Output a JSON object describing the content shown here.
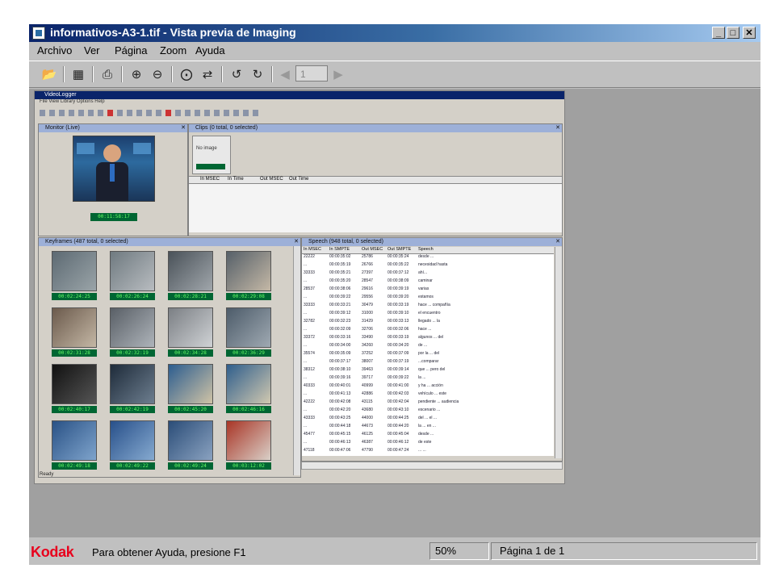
{
  "window": {
    "title": "informativos-A3-1.tif - Vista previa de Imaging",
    "controls": {
      "minimize": "_",
      "maximize": "□",
      "close": "✕"
    }
  },
  "menu": [
    "Archivo",
    "Ver",
    "Página",
    "Zoom",
    "Ayuda"
  ],
  "toolbar": {
    "page_input_value": "1"
  },
  "image_content": {
    "app_title": "VideoLogger",
    "menu_line": "File  View  Library  Options  Help",
    "monitor_title": "Monitor (Live)",
    "monitor_timecode": "00:11:58:17",
    "clips_title": "Clips (0 total, 0 selected)",
    "clips_no_image": "No image",
    "clips_columns": [
      "In MSEC",
      "In Time",
      "Out MSEC",
      "Out Time"
    ],
    "keyframes_title": "Keyframes (487 total, 0 selected)",
    "keyframe_timecodes": [
      "00:02:24:25",
      "00:02:26:24",
      "00:02:28:21",
      "00:02:29:08",
      "00:02:31:28",
      "00:02:32:19",
      "00:02:34:28",
      "00:02:36:29",
      "00:02:40:17",
      "00:02:42:19",
      "00:02:45:20",
      "00:02:46:16",
      "00:02:49:18",
      "00:02:49:22",
      "00:02:49:24",
      "00:03:12:02"
    ],
    "speech_title": "Speech (948 total, 0 selected)",
    "speech_columns": [
      "In MSEC",
      "In SMPTE",
      "Out MSEC",
      "Out SMPTE",
      "Speech"
    ],
    "speech_rows": [
      [
        "22222",
        "00:00:35:02",
        "25786",
        "00:00:35:24",
        "desde ..."
      ],
      [
        "...",
        "00:00:35:19",
        "26766",
        "00:00:35:22",
        "necesidad hasta"
      ],
      [
        "33333",
        "00:00:35:21",
        "27397",
        "00:00:37:12",
        "ahí..."
      ],
      [
        "...",
        "00:00:35:20",
        "28547",
        "00:00:38:09",
        "caminar"
      ],
      [
        "28537",
        "00:00:38:06",
        "29616",
        "00:00:39:19",
        "varias"
      ],
      [
        "...",
        "00:00:39:22",
        "29556",
        "00:00:39:20",
        "estamos"
      ],
      [
        "33333",
        "00:00:33:21",
        "30479",
        "00:00:33:19",
        "hace ... compañía"
      ],
      [
        "...",
        "00:00:39:12",
        "31000",
        "00:00:39:10",
        "el encuentro"
      ],
      [
        "32782",
        "00:00:32:23",
        "31429",
        "00:00:33:13",
        "llegado ... la"
      ],
      [
        "...",
        "00:00:32:09",
        "32706",
        "00:00:32:06",
        "hace ..."
      ],
      [
        "33372",
        "00:00:33:16",
        "33490",
        "00:00:33:19",
        "algunos ... del"
      ],
      [
        "...",
        "00:00:34:00",
        "34260",
        "00:00:34:20",
        "de ..."
      ],
      [
        "35574",
        "00:00:35:09",
        "37252",
        "00:00:37:09",
        "por la ... del"
      ],
      [
        "...",
        "00:00:37:17",
        "38007",
        "00:00:37:19",
        "...comparar"
      ],
      [
        "38312",
        "00:00:38:10",
        "39463",
        "00:00:39:14",
        "que ... pero del"
      ],
      [
        "...",
        "00:00:39:16",
        "39717",
        "00:00:39:22",
        "la ..."
      ],
      [
        "40333",
        "00:00:40:01",
        "40999",
        "00:00:41:00",
        "y ha ... acción"
      ],
      [
        "...",
        "00:00:41:13",
        "42886",
        "00:00:42:03",
        "vehículo ... este"
      ],
      [
        "42222",
        "00:00:42:08",
        "43115",
        "00:00:42:04",
        "pendiente ... audiencia"
      ],
      [
        "...",
        "00:00:42:20",
        "43680",
        "00:00:43:10",
        "escenario ..."
      ],
      [
        "43333",
        "00:00:43:25",
        "44000",
        "00:00:44:25",
        "del ... el ..."
      ],
      [
        "...",
        "00:00:44:18",
        "44673",
        "00:00:44:20",
        "la ... en ..."
      ],
      [
        "45477",
        "00:00:45:15",
        "46125",
        "00:00:45:04",
        "desde ..."
      ],
      [
        "...",
        "00:00:46:13",
        "46387",
        "00:00:46:12",
        "de este"
      ],
      [
        "47118",
        "00:00:47:06",
        "47790",
        "00:00:47:24",
        "... ..."
      ]
    ],
    "ready_label": "Ready"
  },
  "statusbar": {
    "brand": "Kodak",
    "help": "Para obtener Ayuda, presione F1",
    "zoom": "50%",
    "page": "Página 1 de 1"
  }
}
